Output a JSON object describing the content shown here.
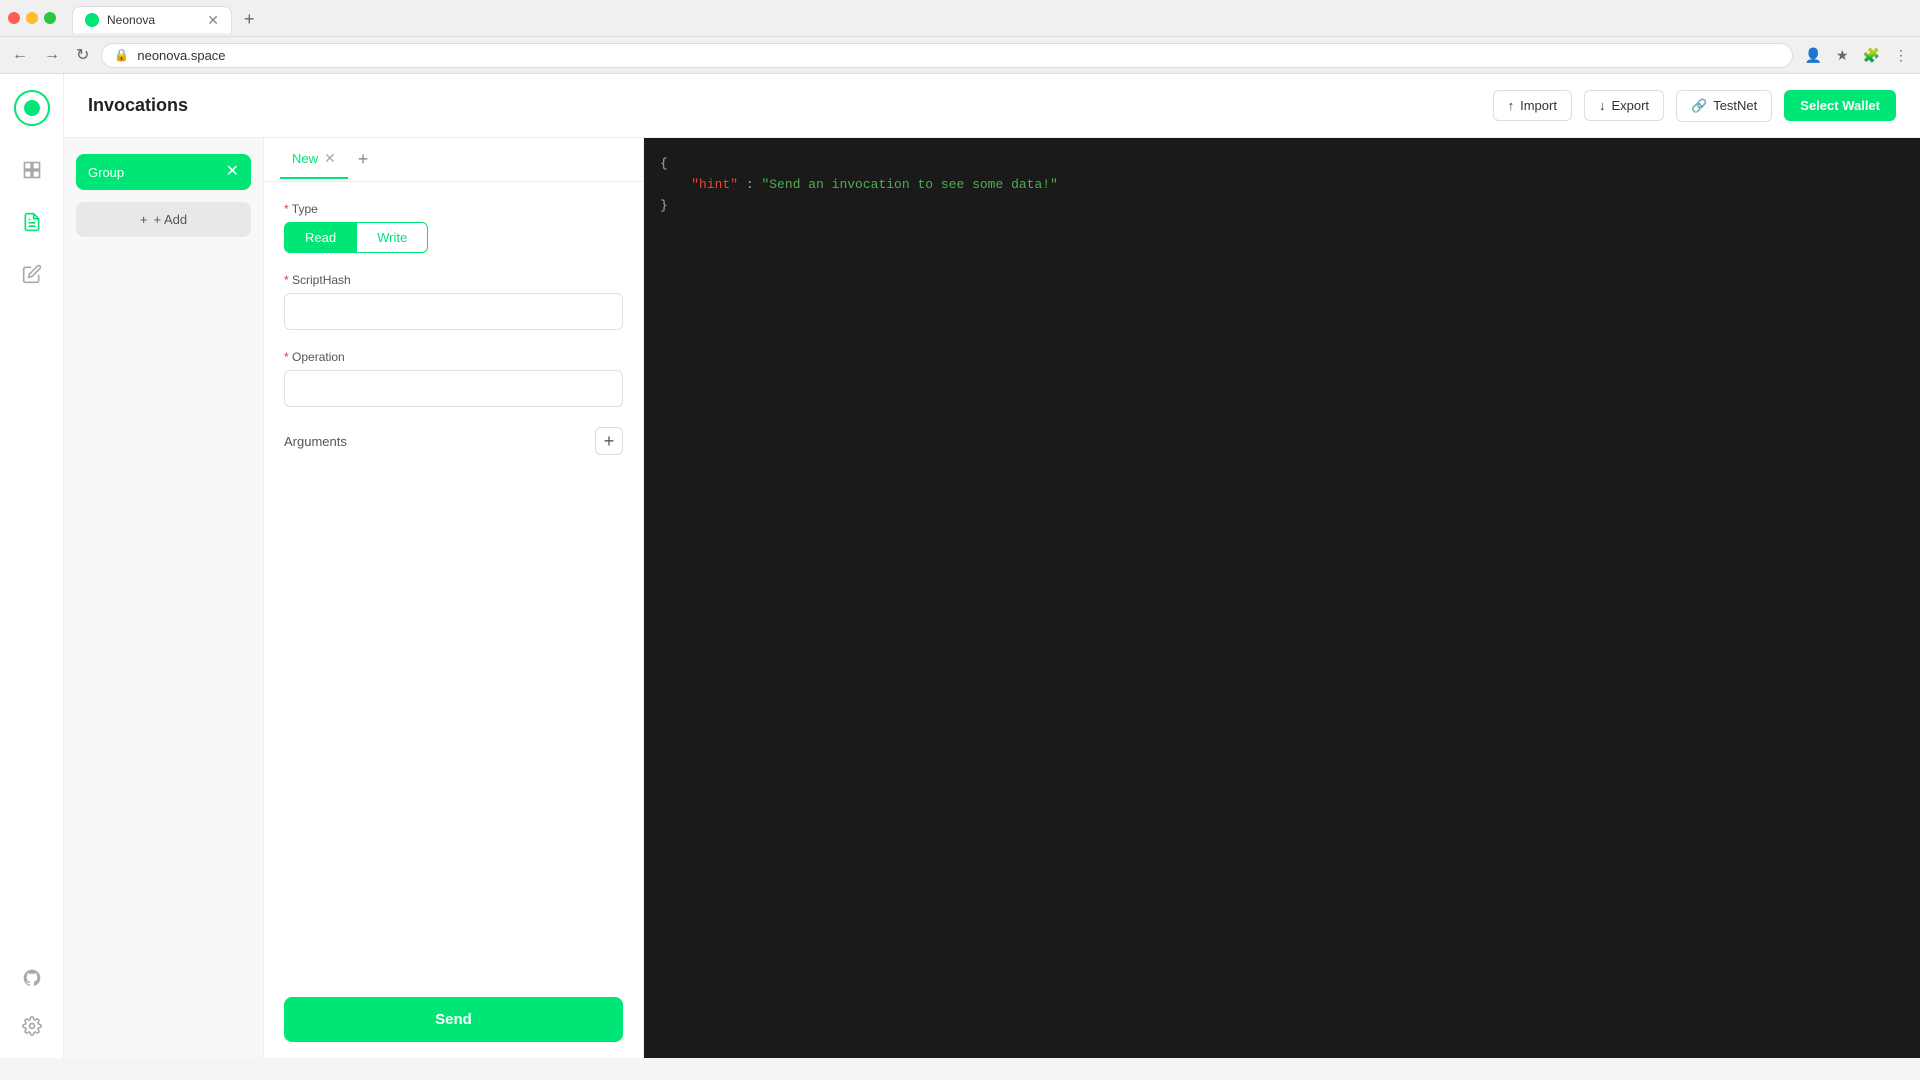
{
  "browser": {
    "tab_title": "Neonova",
    "tab_favicon": "N",
    "url": "neonova.space",
    "new_tab_label": "+",
    "nav": {
      "back": "←",
      "forward": "→",
      "reload": "↻"
    }
  },
  "header": {
    "title": "Invocations",
    "import_label": "Import",
    "export_label": "Export",
    "testnet_label": "TestNet",
    "select_wallet_label": "Select Wallet"
  },
  "groups": {
    "add_label": "+ Add",
    "items": [
      {
        "name": "Group"
      }
    ]
  },
  "tabs": [
    {
      "label": "New",
      "active": true
    }
  ],
  "form": {
    "type_label": "* Type",
    "type_options": [
      "Read",
      "Write"
    ],
    "active_type": "Read",
    "scripthash_label": "* ScriptHash",
    "scripthash_placeholder": "",
    "operation_label": "* Operation",
    "operation_placeholder": "",
    "arguments_label": "Arguments",
    "send_label": "Send"
  },
  "output": {
    "lines": [
      {
        "text": "{",
        "type": "brace"
      },
      {
        "key": "hint",
        "value": "Send an invocation to see some data!",
        "type": "keyvalue"
      },
      {
        "text": "}",
        "type": "brace"
      }
    ]
  },
  "colors": {
    "accent": "#00e676",
    "dark_bg": "#1a1a1a"
  }
}
